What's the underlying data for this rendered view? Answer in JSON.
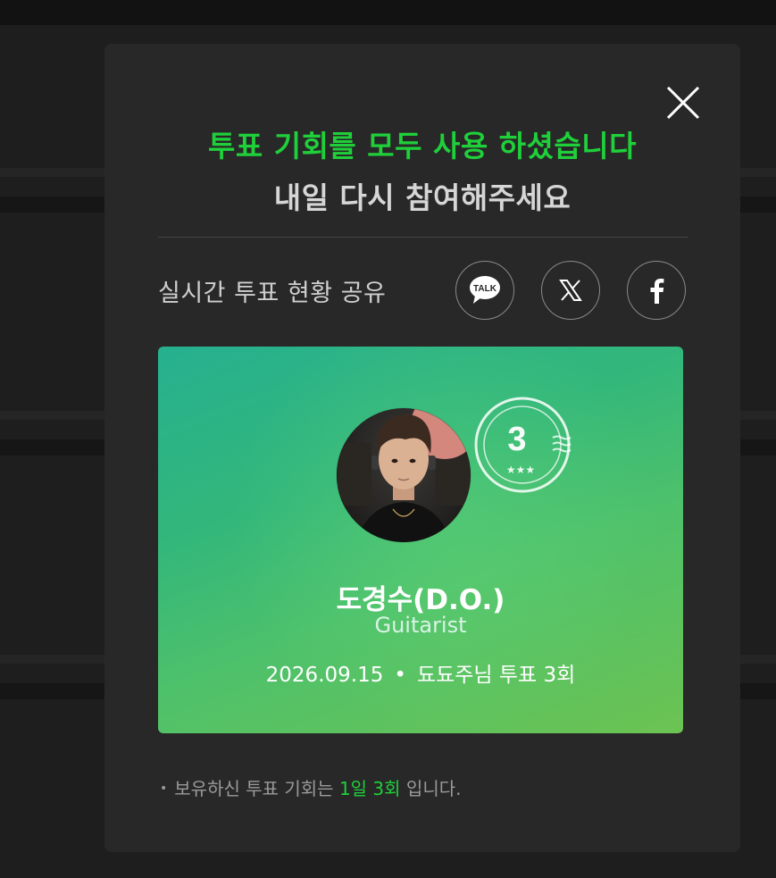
{
  "modal": {
    "title_main": "투표 기회를 모두 사용 하셨습니다",
    "title_sub": "내일 다시 참여해주세요",
    "share": {
      "label": "실시간 투표 현황 공유",
      "kakao_text": "TALK",
      "buttons": [
        "kakaotalk-icon",
        "x-icon",
        "facebook-icon"
      ]
    },
    "card": {
      "artist_name": "도경수(D.O.)",
      "artist_role": "Guitarist",
      "date": "2026.09.15",
      "separator": "•",
      "vote_info": "됴됴주님 투표 3회",
      "stamp_number": "3",
      "stamp_stars": "★★★"
    },
    "note": {
      "bullet": "•",
      "prefix": "보유하신 투표 기회는",
      "highlight": "1일 3회",
      "suffix": "입니다."
    }
  },
  "colors": {
    "accent_green": "#1fd03a",
    "modal_bg": "#282828",
    "page_bg": "#1e1e1e"
  }
}
